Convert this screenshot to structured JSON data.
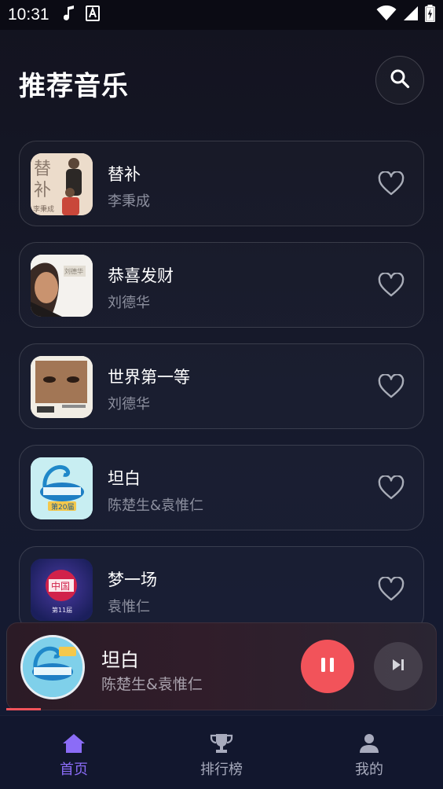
{
  "status_bar": {
    "time": "10:31",
    "left_icons": [
      "music-note-icon",
      "text-a-icon"
    ],
    "right_icons": [
      "wifi-icon",
      "cellular-signal-icon",
      "battery-charging-icon"
    ]
  },
  "header": {
    "title": "推荐音乐",
    "search_icon": "search-icon"
  },
  "songs": [
    {
      "title": "替补",
      "artist": "李秉成",
      "cover_text": "替补",
      "cover_sub": "李秉成",
      "favorited": false
    },
    {
      "title": "恭喜发财",
      "artist": "刘德华",
      "favorited": false
    },
    {
      "title": "世界第一等",
      "artist": "刘德华",
      "favorited": false
    },
    {
      "title": "坦白",
      "artist": "陈楚生&袁惟仁",
      "cover_text": "第20届",
      "favorited": false
    },
    {
      "title": "梦一场",
      "artist": "袁惟仁",
      "cover_text": "第11届",
      "favorited": false
    }
  ],
  "now_playing": {
    "title": "坦白",
    "artist": "陈楚生&袁惟仁",
    "state": "playing",
    "progress": 0.08
  },
  "bottom_nav": [
    {
      "label": "首页",
      "icon": "home-icon",
      "active": true
    },
    {
      "label": "排行榜",
      "icon": "trophy-icon",
      "active": false
    },
    {
      "label": "我的",
      "icon": "person-icon",
      "active": false
    }
  ],
  "colors": {
    "accent": "#8b6cf7",
    "play_button": "#f2535a",
    "background": "#161a2c"
  }
}
